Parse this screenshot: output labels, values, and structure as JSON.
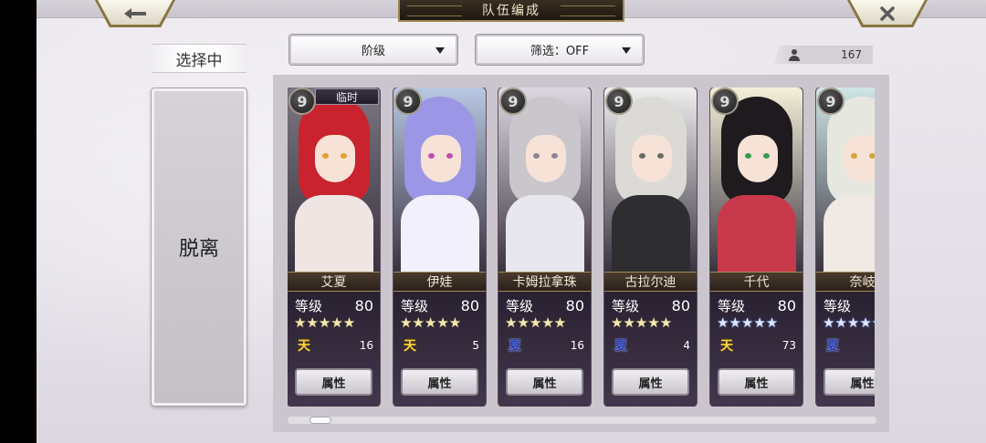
{
  "header": {
    "title": "队伍编成",
    "back_icon": "←",
    "close_icon": "✕"
  },
  "left_panel": {
    "selecting_label": "选择中",
    "leave_label": "脱离"
  },
  "filters": {
    "rank_label": "阶级",
    "filter_label": "筛选：OFF"
  },
  "roster_count": "167",
  "cards": [
    {
      "name": "艾夏",
      "key": "9",
      "tag": "临时",
      "level_label": "等级",
      "level": "80",
      "stars": "★★★★★",
      "star_color": "gold",
      "element": "天",
      "element_type": "sky",
      "count": "16",
      "button": "属性",
      "colors": {
        "hair": "#c8232e",
        "body": "#efe6e4",
        "eye": "#e0a22c",
        "bg": "#7b7680"
      }
    },
    {
      "name": "伊娃",
      "key": "9",
      "tag": "",
      "level_label": "等级",
      "level": "80",
      "stars": "★★★★★",
      "star_color": "gold",
      "element": "天",
      "element_type": "sky",
      "count": "5",
      "button": "属性",
      "colors": {
        "hair": "#9b97e6",
        "body": "#f2f0fa",
        "eye": "#c04bb0",
        "bg": "#b9c8e2"
      }
    },
    {
      "name": "卡姆拉拿珠",
      "key": "9",
      "tag": "",
      "level_label": "等级",
      "level": "80",
      "stars": "★★★★★",
      "star_color": "gold",
      "element": "夏",
      "element_type": "summer",
      "count": "16",
      "button": "属性",
      "colors": {
        "hair": "#c9c6cc",
        "body": "#e9e7ee",
        "eye": "#8a8494",
        "bg": "#ddd9e2"
      }
    },
    {
      "name": "古拉尔迪",
      "key": "9",
      "tag": "",
      "level_label": "等级",
      "level": "80",
      "stars": "★★★★★",
      "star_color": "gold",
      "element": "夏",
      "element_type": "summer",
      "count": "4",
      "button": "属性",
      "colors": {
        "hair": "#dcdad6",
        "body": "#2e2e30",
        "eye": "#6c6a64",
        "bg": "#efefef"
      }
    },
    {
      "name": "千代",
      "key": "9",
      "tag": "",
      "level_label": "等级",
      "level": "80",
      "stars": "★★★★★",
      "star_color": "blue",
      "element": "天",
      "element_type": "sky",
      "count": "73",
      "button": "属性",
      "colors": {
        "hair": "#1f1a1e",
        "body": "#c7394a",
        "eye": "#3a9a52",
        "bg": "#f5f0d8"
      }
    },
    {
      "name": "奈岐",
      "key": "9",
      "tag": "",
      "level_label": "等级",
      "level": "",
      "stars": "★★★★★",
      "star_color": "blue",
      "element": "夏",
      "element_type": "summer",
      "count": "",
      "button": "属性",
      "colors": {
        "hair": "#e6e8e0",
        "body": "#f0e9e4",
        "eye": "#d4a33a",
        "bg": "#cfe6e6"
      }
    }
  ]
}
